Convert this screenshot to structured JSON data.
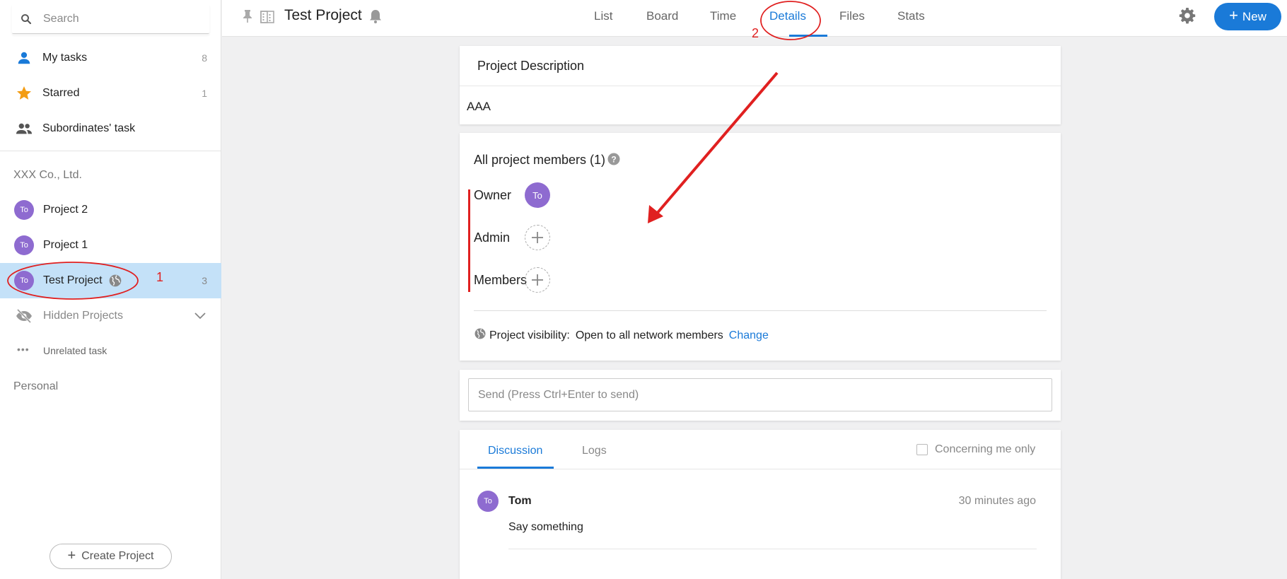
{
  "sidebar": {
    "search_placeholder": "Search",
    "nav": [
      {
        "label": "My tasks",
        "count": "8"
      },
      {
        "label": "Starred",
        "count": "1"
      },
      {
        "label": "Subordinates' task",
        "count": ""
      }
    ],
    "org_title": "XXX Co., Ltd.",
    "projects": [
      {
        "avatar": "To",
        "label": "Project 2",
        "count": ""
      },
      {
        "avatar": "To",
        "label": "Project 1",
        "count": ""
      },
      {
        "avatar": "To",
        "label": "Test Project",
        "count": "3"
      }
    ],
    "hidden_projects": "Hidden Projects",
    "unrelated_task": "Unrelated task",
    "personal": "Personal",
    "create_project": "Create Project"
  },
  "header": {
    "title": "Test Project",
    "tabs": [
      "List",
      "Board",
      "Time",
      "Details",
      "Files",
      "Stats"
    ],
    "active_tab": "Details",
    "new_label": "New"
  },
  "description": {
    "title": "Project Description",
    "body": "AAA"
  },
  "members": {
    "title": "All project members (1)",
    "roles": [
      {
        "label": "Owner",
        "avatar": "To"
      },
      {
        "label": "Admin",
        "avatar": ""
      },
      {
        "label": "Members",
        "avatar": ""
      }
    ],
    "visibility_label": "Project visibility:",
    "visibility_value": "Open to all network members",
    "change_label": "Change"
  },
  "send": {
    "placeholder": "Send (Press Ctrl+Enter to send)"
  },
  "discussion": {
    "tabs": [
      "Discussion",
      "Logs"
    ],
    "filter_label": "Concerning me only",
    "messages": [
      {
        "avatar": "To",
        "author": "Tom",
        "time": "30 minutes ago",
        "text": "Say something"
      }
    ]
  },
  "annotations": {
    "marker_1": "1",
    "marker_2": "2"
  },
  "colors": {
    "accent": "#1a7ad8",
    "avatar": "#8e6bd0",
    "active_project_bg": "#c4e1f8",
    "annotation": "#e02020",
    "star": "#f39c12"
  }
}
